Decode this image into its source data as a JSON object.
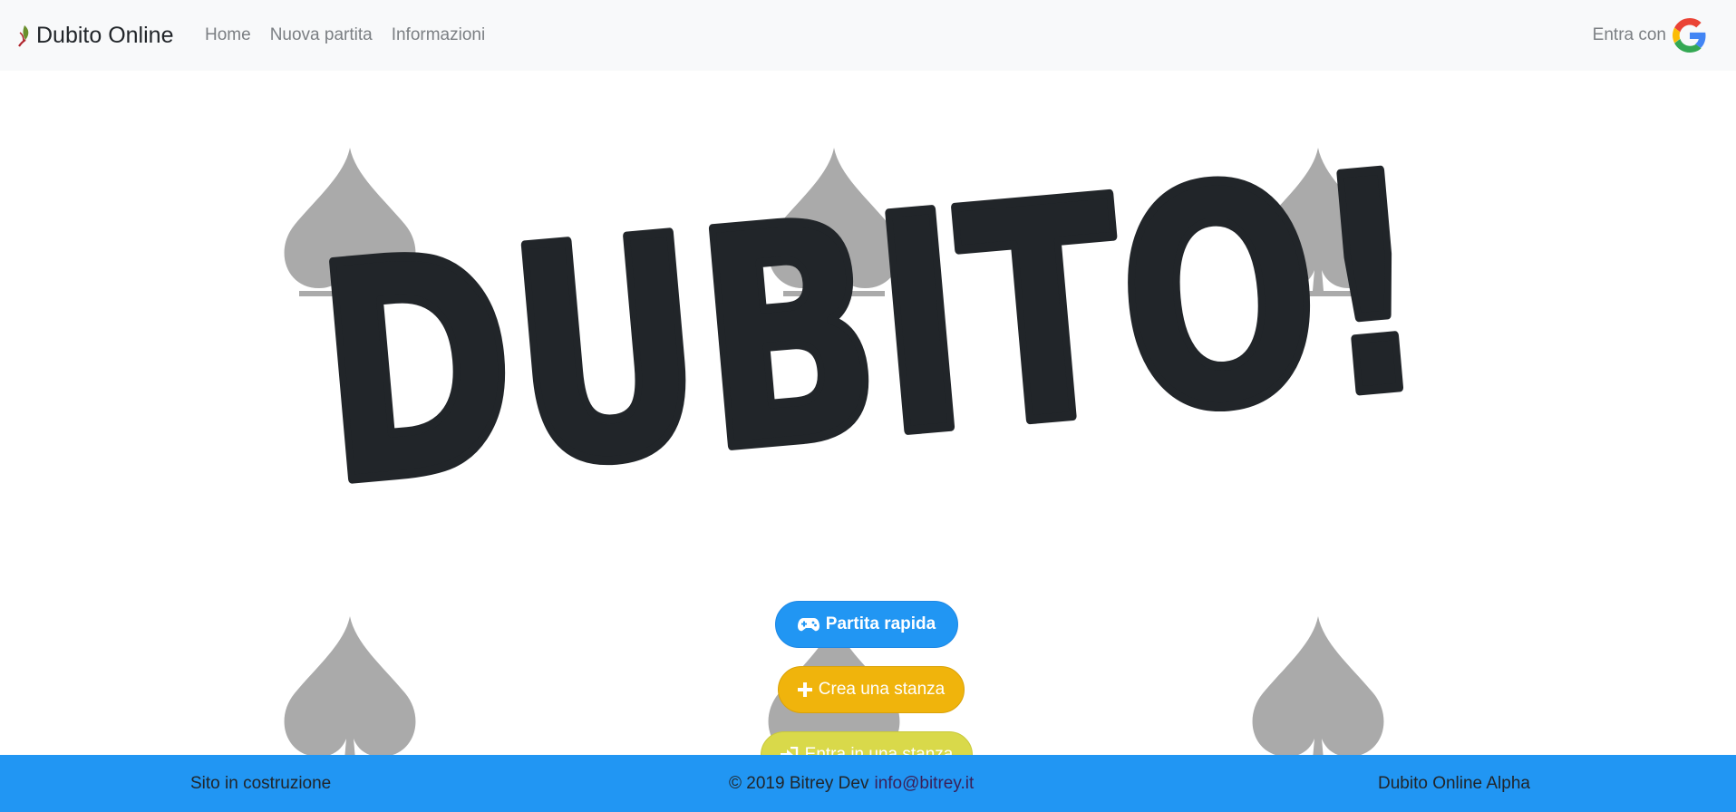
{
  "navbar": {
    "brand": "Dubito Online",
    "links": [
      "Home",
      "Nuova partita",
      "Informazioni"
    ],
    "login_label": "Entra con"
  },
  "hero": {
    "title": "DUBITO!"
  },
  "actions": {
    "quick_game": "Partita rapida",
    "create_room": "Crea una stanza",
    "join_room": "Entra in una stanza"
  },
  "footer": {
    "left": "Sito in costruzione",
    "copyright": "© 2019 Bitrey Dev",
    "email": "info@bitrey.it",
    "right": "Dubito Online Alpha"
  },
  "colors": {
    "primary": "#2196f3",
    "warning": "#f0b40c",
    "lime": "#d9d94a",
    "dark": "#212529",
    "spade": "#aaaaaa"
  },
  "icons": {
    "brand": "leaf-logo-icon",
    "google": "google-icon",
    "quick_game": "gamepad-icon",
    "create_room": "plus-icon",
    "join_room": "sign-in-icon",
    "decor": "spade-icon"
  }
}
